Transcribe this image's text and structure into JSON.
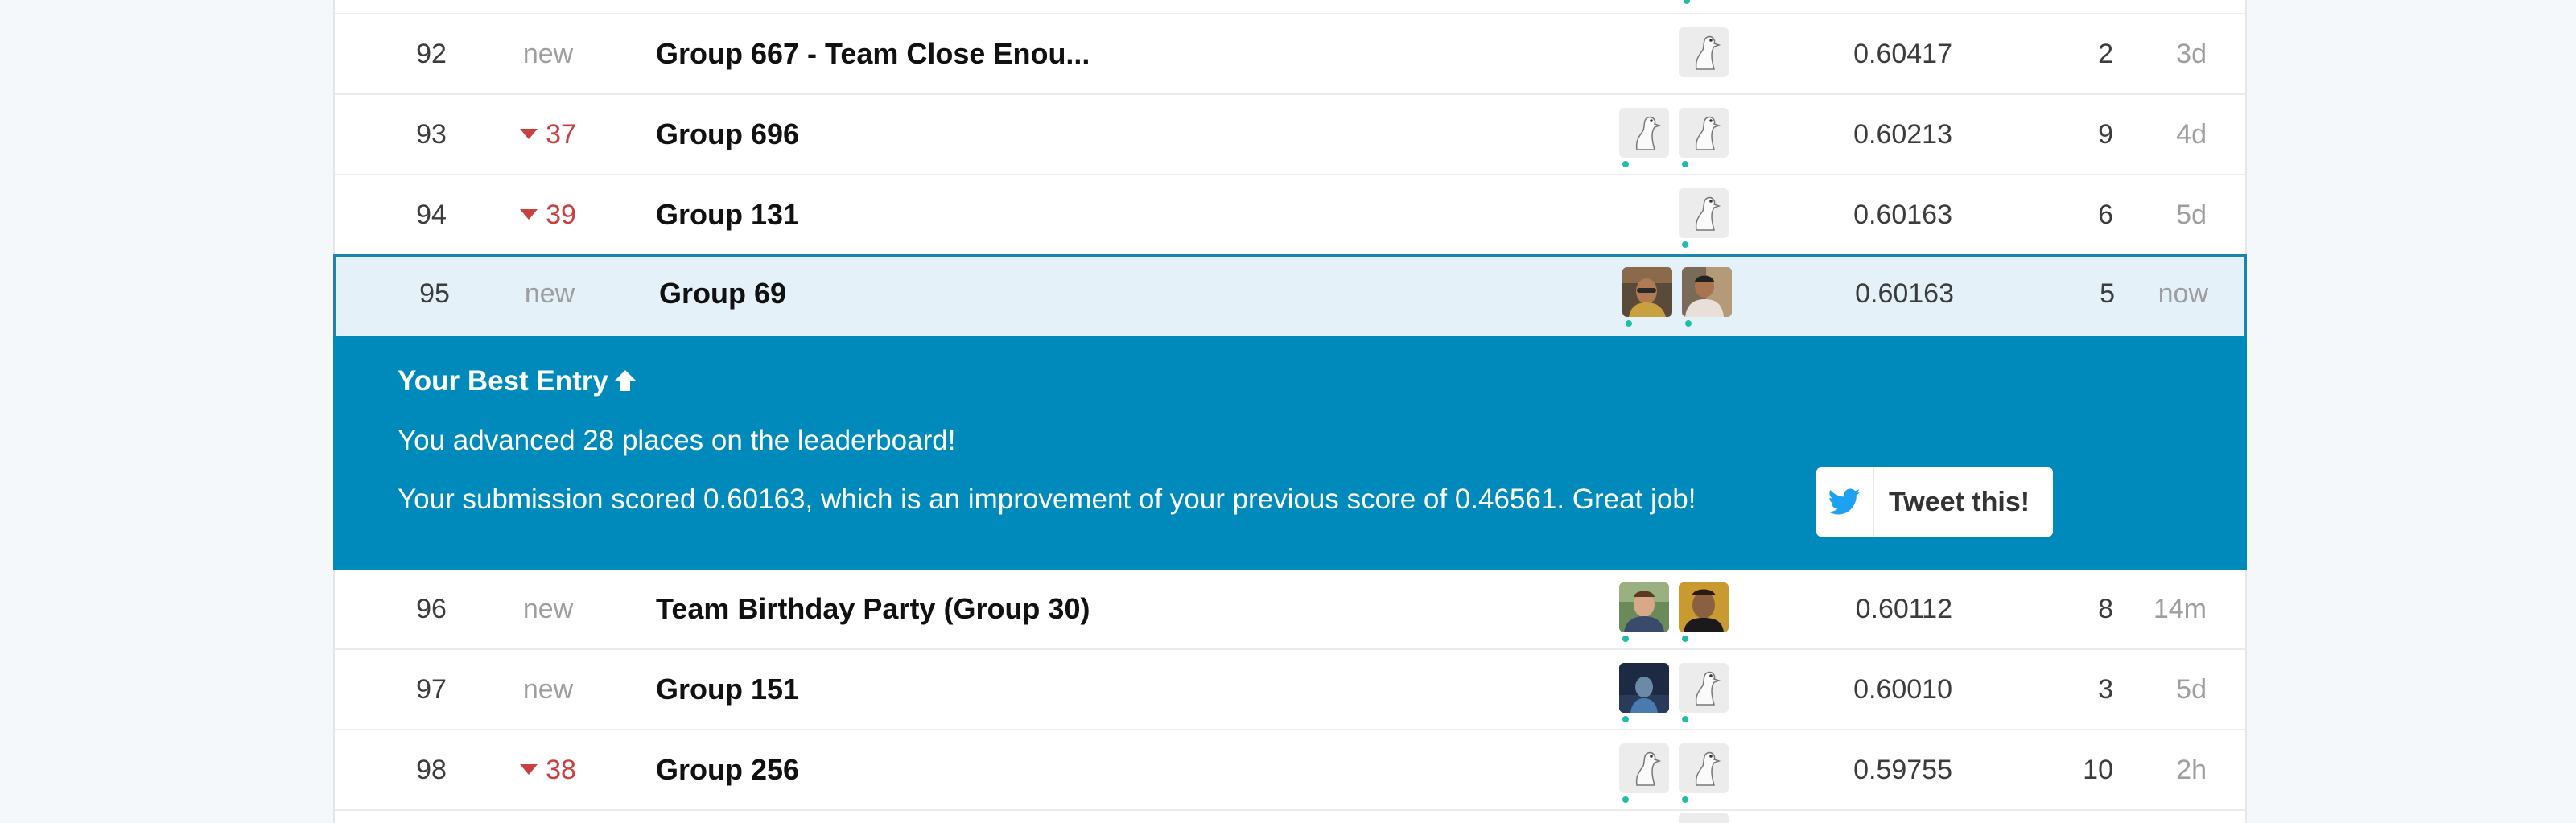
{
  "rows_before": [
    {
      "rank": "92",
      "delta": "new",
      "delta_dir": "new",
      "team": "Group 667 - Team Close Enou...",
      "score": "0.60417",
      "entries": "2",
      "last": "3d",
      "avatars": [
        "default"
      ]
    },
    {
      "rank": "93",
      "delta": "37",
      "delta_dir": "down",
      "team": "Group 696",
      "score": "0.60213",
      "entries": "9",
      "last": "4d",
      "avatars": [
        "default",
        "default"
      ]
    },
    {
      "rank": "94",
      "delta": "39",
      "delta_dir": "down",
      "team": "Group 131",
      "score": "0.60163",
      "entries": "6",
      "last": "5d",
      "avatars": [
        "default"
      ]
    },
    {
      "rank": "95",
      "delta": "new",
      "delta_dir": "new",
      "team": "Group 69",
      "score": "0.60163",
      "entries": "5",
      "last": "now",
      "avatars": [
        "photo",
        "photo"
      ],
      "highlighted": true
    }
  ],
  "banner": {
    "title": "Your Best Entry",
    "arrow_icon": "arrow-up-icon",
    "line1": "You advanced 28 places on the leaderboard!",
    "line2": "Your submission scored 0.60163, which is an improvement of your previous score of 0.46561. Great job!",
    "tweet_label": "Tweet this!",
    "tweet_icon": "twitter-bird-icon",
    "background": "#008abc"
  },
  "rows_after": [
    {
      "rank": "96",
      "delta": "new",
      "delta_dir": "new",
      "team": "Team Birthday Party (Group 30)",
      "score": "0.60112",
      "entries": "8",
      "last": "14m",
      "avatars": [
        "photo",
        "photo"
      ]
    },
    {
      "rank": "97",
      "delta": "new",
      "delta_dir": "new",
      "team": "Group 151",
      "score": "0.60010",
      "entries": "3",
      "last": "5d",
      "avatars": [
        "photo",
        "default"
      ]
    },
    {
      "rank": "98",
      "delta": "38",
      "delta_dir": "down",
      "team": "Group 256",
      "score": "0.59755",
      "entries": "10",
      "last": "2h",
      "avatars": [
        "default",
        "default"
      ]
    }
  ],
  "colors": {
    "accent": "#1b83b6",
    "down": "#c94040",
    "online_dot": "#20beaa",
    "highlight_bg": "#e4f1f8"
  }
}
